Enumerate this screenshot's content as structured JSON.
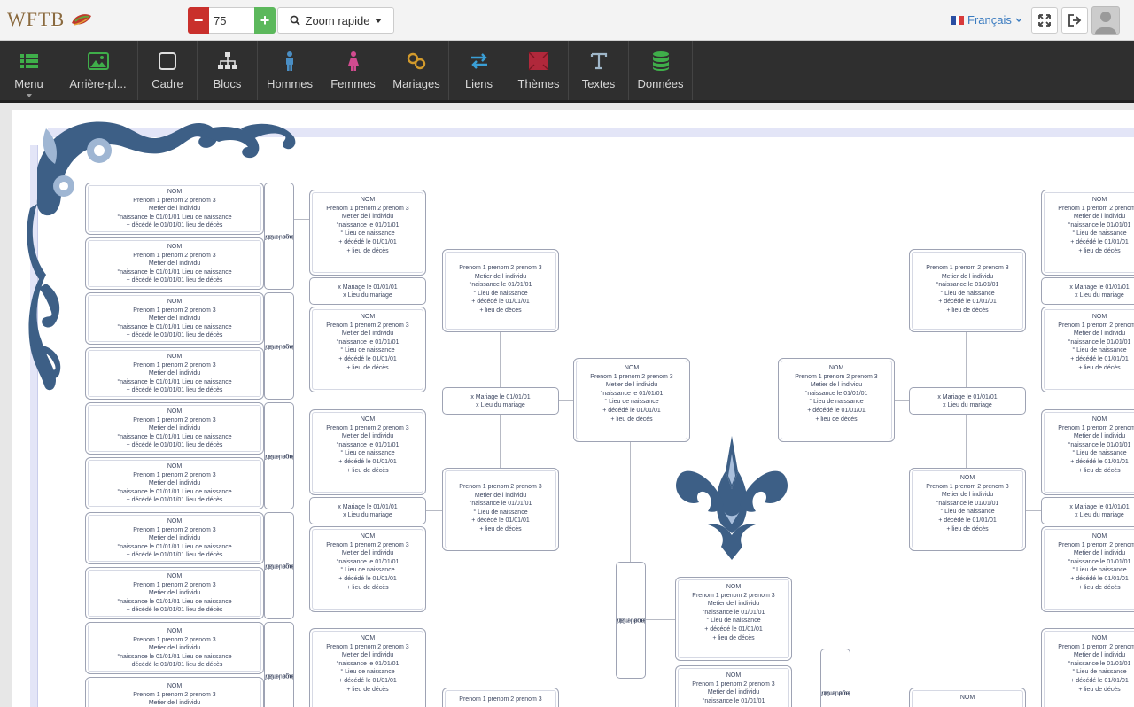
{
  "app": {
    "logo": "WFTB"
  },
  "zoom": {
    "minus": "−",
    "value": "75",
    "plus": "+",
    "rapide_label": "Zoom rapide"
  },
  "header": {
    "language": "Français"
  },
  "toolbar": {
    "items": [
      {
        "label": "Menu",
        "icon": "list-icon",
        "color": "#3fae4a"
      },
      {
        "label": "Arrière-pl...",
        "icon": "image-icon",
        "color": "#3fae4a"
      },
      {
        "label": "Cadre",
        "icon": "square-icon",
        "color": "#e0e0e0"
      },
      {
        "label": "Blocs",
        "icon": "sitemap-icon",
        "color": "#e0e0e0"
      },
      {
        "label": "Hommes",
        "icon": "male-icon",
        "color": "#4a8ec4"
      },
      {
        "label": "Femmes",
        "icon": "female-icon",
        "color": "#d14b8f"
      },
      {
        "label": "Mariages",
        "icon": "rings-icon",
        "color": "#d29a2c"
      },
      {
        "label": "Liens",
        "icon": "exchange-icon",
        "color": "#3a9fd6"
      },
      {
        "label": "Thèmes",
        "icon": "theme-swatch-icon",
        "color": "#b0283b"
      },
      {
        "label": "Textes",
        "icon": "text-icon",
        "color": "#9fb6c8"
      },
      {
        "label": "Données",
        "icon": "database-icon",
        "color": "#3fae4a"
      }
    ]
  },
  "person": {
    "nom": "NOM",
    "prenoms": "Prenom 1 prenom 2 prenom 3",
    "metier": "Metier de l individu",
    "naissance": "°naissance le 01/01/01",
    "lieu_naissance": "° Lieu de naissance",
    "deces": "+ décédé le 01/01/01",
    "lieu_deces": "+ lieu de décès",
    "naissance_full": "°naissance le 01/01/01 Lieu de naissance",
    "deces_full": "+ décédé le 01/01/01 lieu de décès"
  },
  "mariage": {
    "line1": "x Mariage le 01/01/01",
    "line2": "x Lieu du mariage"
  }
}
